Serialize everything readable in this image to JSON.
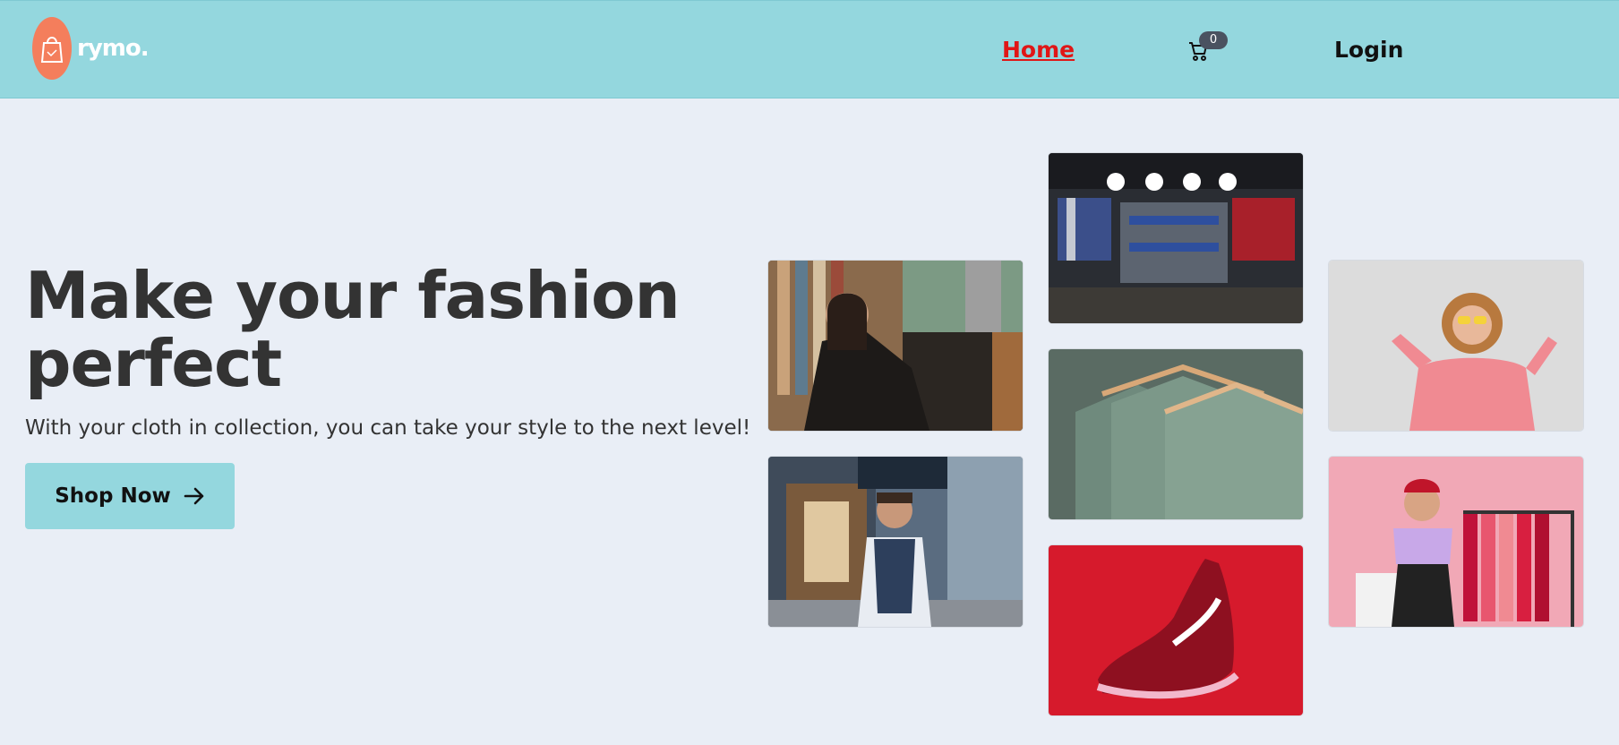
{
  "header": {
    "logo_text": "rymo.",
    "nav": {
      "home_label": "Home",
      "cart_count": "0",
      "login_label": "Login"
    }
  },
  "hero": {
    "title": "Make your fashion perfect",
    "subtitle": "With your cloth in collection, you can take your style to the next level!",
    "cta_label": "Shop Now"
  },
  "colors": {
    "header_bg": "#94d7de",
    "page_bg": "#e9eef6",
    "logo_accent": "#f47e5c",
    "nav_active": "#e01616",
    "cta_bg": "#94d7de"
  },
  "gallery": [
    {
      "name": "man-browsing-jackets"
    },
    {
      "name": "man-in-vest-street"
    },
    {
      "name": "clothing-store-interior"
    },
    {
      "name": "green-tshirts-on-hangers"
    },
    {
      "name": "red-sneaker"
    },
    {
      "name": "woman-pink-hoodie"
    },
    {
      "name": "woman-with-clothes-rack"
    }
  ]
}
